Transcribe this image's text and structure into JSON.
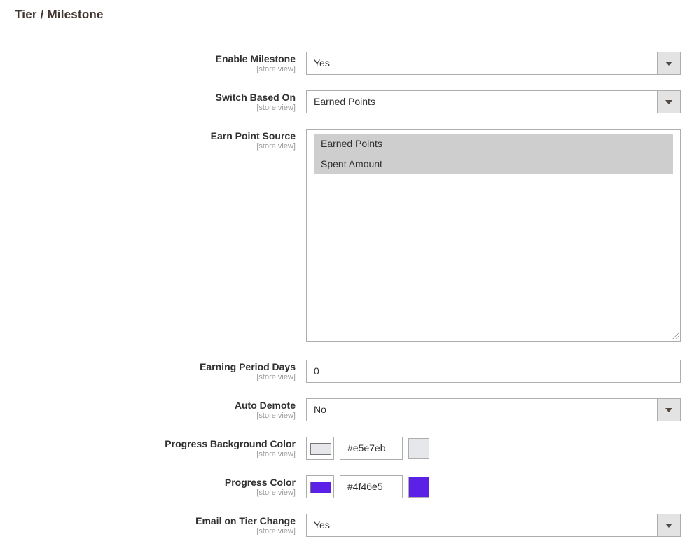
{
  "section": {
    "title": "Tier / Milestone"
  },
  "fields": {
    "enable_milestone": {
      "label": "Enable Milestone",
      "scope": "[store view]",
      "value": "Yes"
    },
    "switch_based_on": {
      "label": "Switch Based On",
      "scope": "[store view]",
      "value": "Earned Points"
    },
    "earn_point_source": {
      "label": "Earn Point Source",
      "scope": "[store view]",
      "options": [
        "Earned Points",
        "Spent Amount"
      ]
    },
    "earning_period_days": {
      "label": "Earning Period Days",
      "scope": "[store view]",
      "value": "0"
    },
    "auto_demote": {
      "label": "Auto Demote",
      "scope": "[store view]",
      "value": "No"
    },
    "progress_bg_color": {
      "label": "Progress Background Color",
      "scope": "[store view]",
      "value": "#e5e7eb",
      "color": "#e5e7eb"
    },
    "progress_color": {
      "label": "Progress Color",
      "scope": "[store view]",
      "value": "#4f46e5",
      "color": "#5b21e6"
    },
    "email_on_tier_change": {
      "label": "Email on Tier Change",
      "scope": "[store view]",
      "value": "Yes"
    }
  },
  "icons": {
    "dropdown": "chevron-down-icon",
    "resize": "resize-handle-icon"
  }
}
